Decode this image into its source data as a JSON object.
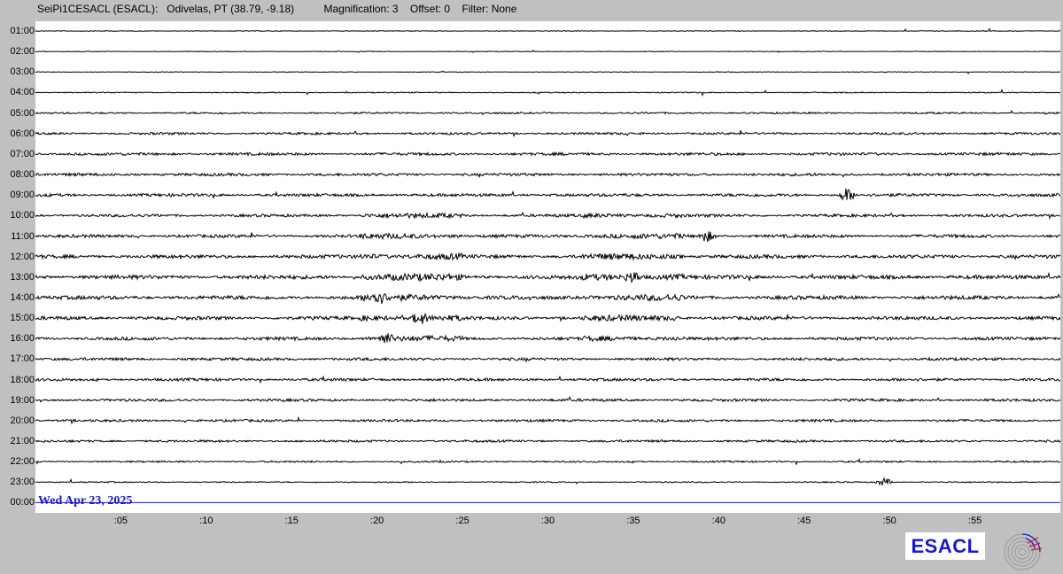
{
  "header": {
    "station": "SeiPi1CESACL (ESACL):",
    "location": "Odivelas, PT (38.79, -9.18)",
    "magnification": "Magnification: 3",
    "offset": "Offset: 0",
    "filter": "Filter: None"
  },
  "date_label": "Wed Apr 23, 2025",
  "logo": {
    "text": "ESACL"
  },
  "colors": {
    "trace": "#000000",
    "last_line": "#1a1acc",
    "background": "#c0c0c0",
    "plot_bg": "#ffffff",
    "logo_text": "#1a1acc"
  },
  "chart_data": {
    "type": "line",
    "title": "",
    "xlabel": "",
    "ylabel": "",
    "x_unit": "minutes past the hour",
    "xlim": [
      0,
      60
    ],
    "x_ticks": [
      ":05",
      ":10",
      ":15",
      ":20",
      ":25",
      ":30",
      ":35",
      ":40",
      ":45",
      ":50",
      ":55"
    ],
    "x_tick_values": [
      5,
      10,
      15,
      20,
      25,
      30,
      35,
      40,
      45,
      50,
      55
    ],
    "hour_labels": [
      "01:00",
      "02:00",
      "03:00",
      "04:00",
      "05:00",
      "06:00",
      "07:00",
      "08:00",
      "09:00",
      "10:00",
      "11:00",
      "12:00",
      "13:00",
      "14:00",
      "15:00",
      "16:00",
      "17:00",
      "18:00",
      "19:00",
      "20:00",
      "21:00",
      "22:00",
      "23:00",
      "00:00"
    ],
    "series_note": "helicorder seismogram, one trace per hour",
    "trace_activity": [
      0.4,
      0.4,
      0.4,
      0.6,
      1.0,
      1.3,
      1.6,
      1.6,
      1.7,
      1.6,
      1.8,
      2.1,
      2.3,
      2.2,
      2.0,
      1.8,
      1.6,
      1.6,
      1.5,
      1.4,
      1.3,
      1.0,
      0.7,
      0.0
    ],
    "events": [
      {
        "hour": "09:00",
        "minute": 47.5,
        "amplitude": 2.5
      },
      {
        "hour": "11:00",
        "minute": 39.3,
        "amplitude": 2.0
      },
      {
        "hour": "13:00",
        "minute": 35.0,
        "amplitude": 2.0
      },
      {
        "hour": "14:00",
        "minute": 20.0,
        "amplitude": 2.0
      },
      {
        "hour": "15:00",
        "minute": 22.5,
        "amplitude": 2.0
      },
      {
        "hour": "16:00",
        "minute": 20.5,
        "amplitude": 1.8
      },
      {
        "hour": "23:00",
        "minute": 49.7,
        "amplitude": 1.5
      }
    ],
    "grid": false,
    "legend": "none"
  }
}
